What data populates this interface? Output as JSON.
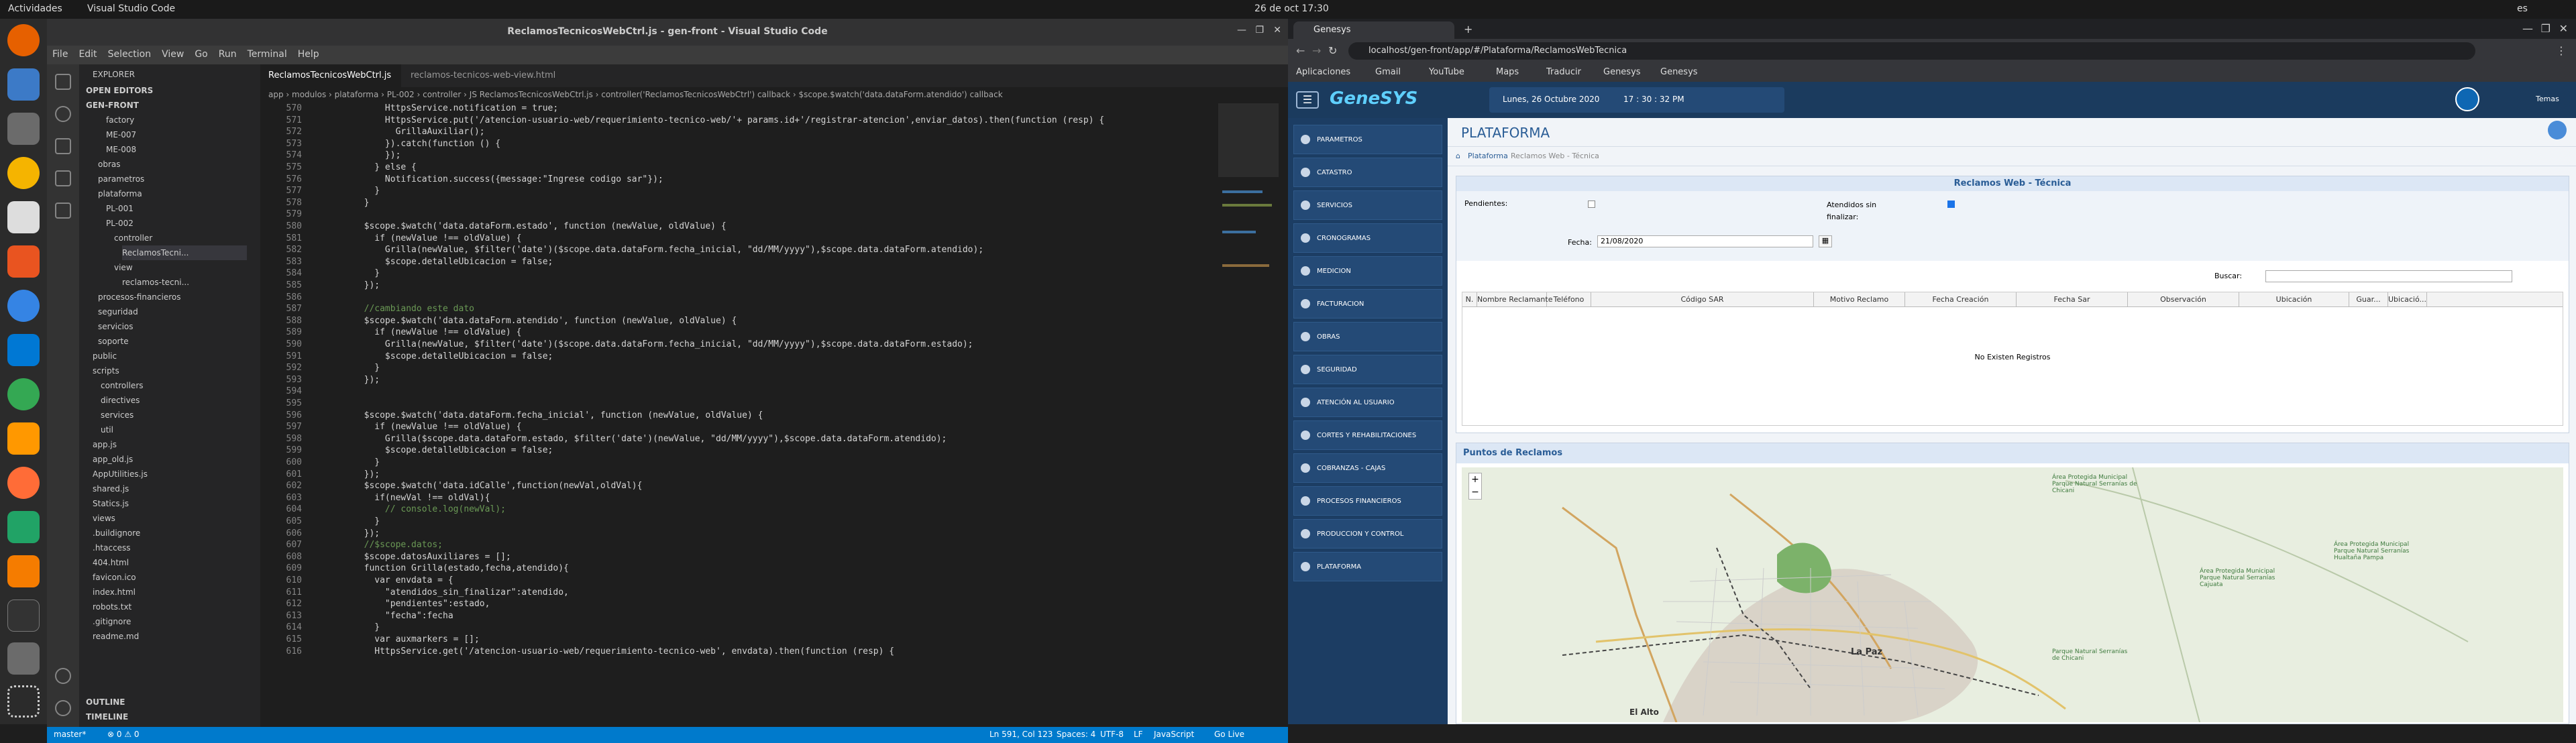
{
  "system": {
    "activities": "Actividades",
    "app": "Visual Studio Code",
    "clock": "26 de oct  17:30",
    "lang": "es"
  },
  "vscode": {
    "title": "ReclamosTecnicosWebCtrl.js - gen-front - Visual Studio Code",
    "menu": [
      "File",
      "Edit",
      "Selection",
      "View",
      "Go",
      "Run",
      "Terminal",
      "Help"
    ],
    "explorer": {
      "title": "EXPLORER",
      "open_editors": "OPEN EDITORS",
      "root": "GEN-FRONT",
      "items": [
        "factory",
        "ME-007",
        "ME-008",
        "obras",
        "parametros",
        "plataforma",
        "PL-001",
        "PL-002",
        "controller",
        "ReclamosTecni...",
        "view",
        "reclamos-tecni...",
        "procesos-financieros",
        "seguridad",
        "servicios",
        "soporte",
        "public",
        "scripts",
        "controllers",
        "directives",
        "services",
        "util",
        "app.js",
        "app_old.js",
        "AppUtilities.js",
        "shared.js",
        "Statics.js",
        "views",
        ".buildignore",
        ".htaccess",
        "404.html",
        "favicon.ico",
        "index.html",
        "robots.txt",
        ".gitignore",
        "readme.md"
      ],
      "outline": "OUTLINE",
      "timeline": "TIMELINE"
    },
    "tabs": [
      "ReclamosTecnicosWebCtrl.js",
      "reclamos-tecnicos-web-view.html"
    ],
    "breadcrumb": "app › modulos › plataforma › PL-002 › controller › JS ReclamosTecnicosWebCtrl.js › controller('ReclamosTecnicosWebCtrl') callback › $scope.$watch('data.dataForm.atendido') callback",
    "code": [
      {
        "n": "570",
        "t": "            HttpsService.notification = true;"
      },
      {
        "n": "571",
        "t": "            HttpsService.put('/atencion-usuario-web/requerimiento-tecnico-web/'+ params.id+'/registrar-atencion',enviar_datos).then(function (resp) {"
      },
      {
        "n": "572",
        "t": "              GrillaAuxiliar();"
      },
      {
        "n": "573",
        "t": "            }).catch(function () {"
      },
      {
        "n": "574",
        "t": "            });"
      },
      {
        "n": "575",
        "t": "          } else {"
      },
      {
        "n": "576",
        "t": "            Notification.success({message:\"Ingrese codigo sar\"});"
      },
      {
        "n": "577",
        "t": "          }"
      },
      {
        "n": "578",
        "t": "        }"
      },
      {
        "n": "579",
        "t": ""
      },
      {
        "n": "580",
        "t": "        $scope.$watch('data.dataForm.estado', function (newValue, oldValue) {"
      },
      {
        "n": "581",
        "t": "          if (newValue !== oldValue) {"
      },
      {
        "n": "582",
        "t": "            Grilla(newValue, $filter('date')($scope.data.dataForm.fecha_inicial, \"dd/MM/yyyy\"),$scope.data.dataForm.atendido);"
      },
      {
        "n": "583",
        "t": "            $scope.detalleUbicacion = false;"
      },
      {
        "n": "584",
        "t": "          }"
      },
      {
        "n": "585",
        "t": "        });"
      },
      {
        "n": "586",
        "t": ""
      },
      {
        "n": "587",
        "t": "        //cambiando este dato"
      },
      {
        "n": "588",
        "t": "        $scope.$watch('data.dataForm.atendido', function (newValue, oldValue) {"
      },
      {
        "n": "589",
        "t": "          if (newValue !== oldValue) {"
      },
      {
        "n": "590",
        "t": "            Grilla(newValue, $filter('date')($scope.data.dataForm.fecha_inicial, \"dd/MM/yyyy\"),$scope.data.dataForm.estado);"
      },
      {
        "n": "591",
        "t": "            $scope.detalleUbicacion = false;"
      },
      {
        "n": "592",
        "t": "          }"
      },
      {
        "n": "593",
        "t": "        });"
      },
      {
        "n": "594",
        "t": ""
      },
      {
        "n": "595",
        "t": ""
      },
      {
        "n": "596",
        "t": "        $scope.$watch('data.dataForm.fecha_inicial', function (newValue, oldValue) {"
      },
      {
        "n": "597",
        "t": "          if (newValue !== oldValue) {"
      },
      {
        "n": "598",
        "t": "            Grilla($scope.data.dataForm.estado, $filter('date')(newValue, \"dd/MM/yyyy\"),$scope.data.dataForm.atendido);"
      },
      {
        "n": "599",
        "t": "            $scope.detalleUbicacion = false;"
      },
      {
        "n": "600",
        "t": "          }"
      },
      {
        "n": "601",
        "t": "        });"
      },
      {
        "n": "602",
        "t": "        $scope.$watch('data.idCalle',function(newVal,oldVal){"
      },
      {
        "n": "603",
        "t": "          if(newVal !== oldVal){"
      },
      {
        "n": "604",
        "t": "            // console.log(newVal);"
      },
      {
        "n": "605",
        "t": "          }"
      },
      {
        "n": "606",
        "t": "        });"
      },
      {
        "n": "607",
        "t": "        //$scope.datos;"
      },
      {
        "n": "608",
        "t": "        $scope.datosAuxiliares = [];"
      },
      {
        "n": "609",
        "t": "        function Grilla(estado,fecha,atendido){"
      },
      {
        "n": "610",
        "t": "          var envdata = {"
      },
      {
        "n": "611",
        "t": "            \"atendidos_sin_finalizar\":atendido,"
      },
      {
        "n": "612",
        "t": "            \"pendientes\":estado,"
      },
      {
        "n": "613",
        "t": "            \"fecha\":fecha"
      },
      {
        "n": "614",
        "t": "          }"
      },
      {
        "n": "615",
        "t": "          var auxmarkers = [];"
      },
      {
        "n": "616",
        "t": "          HttpsService.get('/atencion-usuario-web/requerimiento-tecnico-web', envdata).then(function (resp) {"
      }
    ],
    "status": {
      "branch": "master*",
      "problems": "⊗ 0 ⚠ 0",
      "position": "Ln 591, Col 123",
      "spaces": "Spaces: 4",
      "encoding": "UTF-8",
      "eol": "LF",
      "language": "JavaScript",
      "golive": "Go Live"
    }
  },
  "chrome": {
    "tab_title": "Genesys",
    "url": "localhost/gen-front/app/#/Plataforma/ReclamosWebTecnica",
    "bookmarks": [
      "Aplicaciones",
      "Gmail",
      "YouTube",
      "Maps",
      "Traducir",
      "Genesys",
      "Genesys"
    ]
  },
  "genesys": {
    "logo": "GeneSYS",
    "date": "Lunes, 26 Octubre 2020",
    "time": "17 : 30 : 32 PM",
    "user_menu": "Temas",
    "menu": [
      "PARAMETROS",
      "CATASTRO",
      "SERVICIOS",
      "CRONOGRAMAS",
      "MEDICION",
      "FACTURACION",
      "OBRAS",
      "SEGURIDAD",
      "ATENCIÓN AL USUARIO",
      "CORTES Y REHABILITACIONES",
      "COBRANZAS - CAJAS",
      "PROCESOS FINANCIEROS",
      "PRODUCCION Y CONTROL",
      "PLATAFORMA"
    ],
    "page_title": "PLATAFORMA",
    "breadcrumb": [
      "Plataforma",
      "Reclamos Web - Técnica"
    ],
    "panel_title": "Reclamos Web - Técnica",
    "pendientes_label": "Pendientes:",
    "atendidos_label": "Atendidos sin finalizar:",
    "fecha_label": "Fecha:",
    "fecha_value": "21/08/2020",
    "buscar_label": "Buscar:",
    "columns": [
      "N.",
      "Nombre Reclamante",
      "Teléfono",
      "Código SAR",
      "Motivo Reclamo",
      "Fecha Creación",
      "Fecha Sar",
      "Observación",
      "Ubicación",
      "Guar...",
      "Ubicació..."
    ],
    "empty": "No Existen Registros",
    "map_title": "Puntos de Reclamos",
    "map_labels": [
      "La Paz",
      "El Alto",
      "Área Protegida Municipal Parque Natural Serranías de Chicani",
      "Parque Natural Serranías de Chicani",
      "Área Protegida Municipal Parque Natural Serranías Cajuata",
      "Área Protegida Municipal Parque Natural Serranías Hualtaña Pampa"
    ]
  }
}
